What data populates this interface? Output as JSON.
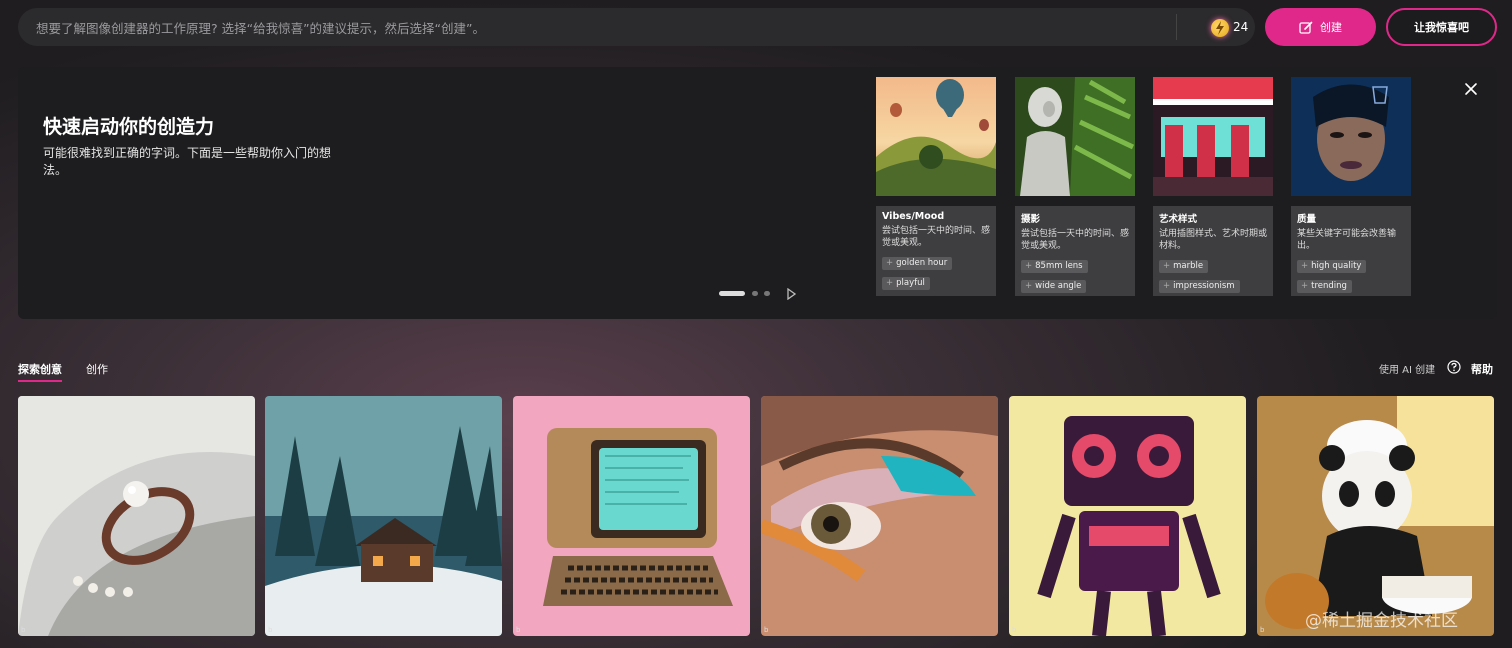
{
  "search": {
    "placeholder": "想要了解图像创建器的工作原理? 选择“给我惊喜”的建议提示，然后选择“创建”。",
    "boost_count": "24"
  },
  "buttons": {
    "create": "创建",
    "surprise": "让我惊喜吧"
  },
  "onboarding": {
    "title": "快速启动你的创造力",
    "subtitle": "可能很难找到正确的字词。下面是一些帮助你入门的想法。",
    "cards": [
      {
        "title": "Vibes/Mood",
        "desc": "尝试包括一天中的时间、感觉或美观。",
        "tags": [
          "golden hour",
          "playful"
        ]
      },
      {
        "title": "摄影",
        "desc": "尝试包括一天中的时间、感觉或美观。",
        "tags": [
          "85mm lens",
          "wide angle"
        ]
      },
      {
        "title": "艺术样式",
        "desc": "试用插图样式、艺术时期或材料。",
        "tags": [
          "marble",
          "impressionism"
        ]
      },
      {
        "title": "质量",
        "desc": "某些关键字可能会改善输出。",
        "tags": [
          "high quality",
          "trending"
        ]
      }
    ]
  },
  "tabs": {
    "explore": "探索创意",
    "create": "创作"
  },
  "links": {
    "create_with_ai": "使用 AI 创建",
    "help": "帮助"
  },
  "gallery_mark": "b",
  "watermark": "@稀土掘金技术社区",
  "colors": {
    "accent": "#e0288a",
    "panel": "#1d1c1e",
    "card_info": "#3e3d40"
  }
}
